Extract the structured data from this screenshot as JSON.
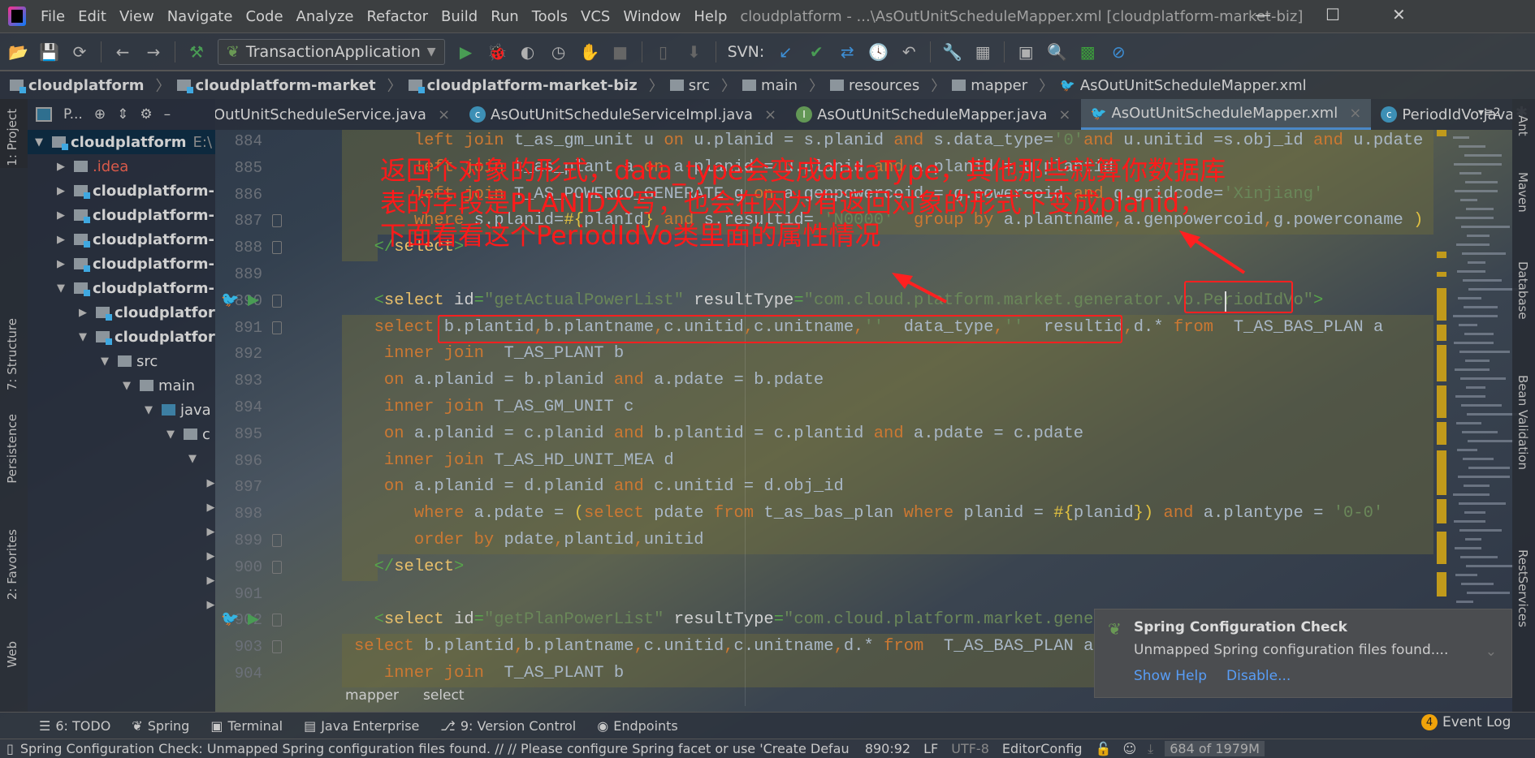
{
  "window": {
    "title": "cloudplatform - ...\\AsOutUnitScheduleMapper.xml [cloudplatform-market-biz]",
    "menu": [
      "File",
      "Edit",
      "View",
      "Navigate",
      "Code",
      "Analyze",
      "Refactor",
      "Build",
      "Run",
      "Tools",
      "VCS",
      "Window",
      "Help"
    ]
  },
  "toolbar": {
    "run_config": "TransactionApplication",
    "svn_label": "SVN:"
  },
  "breadcrumbs": [
    "cloudplatform",
    "cloudplatform-market",
    "cloudplatform-market-biz",
    "src",
    "main",
    "resources",
    "mapper",
    "AsOutUnitScheduleMapper.xml"
  ],
  "project_panel": {
    "view_label": "P...",
    "tree": [
      {
        "label": "cloudplatform",
        "suffix": "E:\\",
        "expanded": true,
        "depth": 0,
        "selected": true
      },
      {
        "label": ".idea",
        "expanded": false,
        "depth": 1
      },
      {
        "label": "cloudplatform-",
        "expanded": false,
        "depth": 1
      },
      {
        "label": "cloudplatform-",
        "expanded": false,
        "depth": 1
      },
      {
        "label": "cloudplatform-",
        "expanded": false,
        "depth": 1
      },
      {
        "label": "cloudplatform-",
        "expanded": false,
        "depth": 1
      },
      {
        "label": "cloudplatform-",
        "expanded": true,
        "depth": 1
      },
      {
        "label": "cloudplatfor",
        "expanded": false,
        "depth": 2
      },
      {
        "label": "cloudplatfor",
        "expanded": true,
        "depth": 2
      },
      {
        "label": "src",
        "expanded": true,
        "depth": 3
      },
      {
        "label": "main",
        "expanded": true,
        "depth": 4
      },
      {
        "label": "java",
        "expanded": true,
        "depth": 5
      },
      {
        "label": "c",
        "expanded": true,
        "depth": 6
      },
      {
        "label": "",
        "expanded": true,
        "depth": 7
      },
      {
        "label": "",
        "expanded": false,
        "depth": 8
      },
      {
        "label": "",
        "expanded": false,
        "depth": 8
      },
      {
        "label": "",
        "expanded": false,
        "depth": 8
      },
      {
        "label": "",
        "expanded": false,
        "depth": 8
      },
      {
        "label": "",
        "expanded": false,
        "depth": 8
      },
      {
        "label": "",
        "expanded": false,
        "depth": 8
      }
    ]
  },
  "left_tool_windows": [
    "1: Project",
    "7: Structure",
    "Persistence",
    "2: Favorites",
    "Web"
  ],
  "right_tool_windows": [
    "Ant",
    "Maven",
    "Database",
    "Bean Validation",
    "RestServices"
  ],
  "tabs": [
    {
      "label": "OutUnitScheduleService.java",
      "icon": "interface",
      "active": false
    },
    {
      "label": "AsOutUnitScheduleServiceImpl.java",
      "icon": "class",
      "active": false
    },
    {
      "label": "AsOutUnitScheduleMapper.java",
      "icon": "interface",
      "active": false
    },
    {
      "label": "AsOutUnitScheduleMapper.xml",
      "icon": "mybatis",
      "active": true
    },
    {
      "label": "PeriodIdVo.java",
      "icon": "class",
      "active": false
    }
  ],
  "tabs_overflow": "2",
  "editor": {
    "lines": [
      {
        "n": 884,
        "tokens": [
          [
            "t",
            "      "
          ],
          [
            "k",
            "left join"
          ],
          [
            "t",
            " t_as_gm_unit u "
          ],
          [
            "k",
            "on"
          ],
          [
            "t",
            " u.planid = s.planid "
          ],
          [
            "k",
            "and"
          ],
          [
            "t",
            " s.data_type="
          ],
          [
            "s",
            "'0'"
          ],
          [
            "k",
            "and"
          ],
          [
            "t",
            " u.unitid =s.obj_id "
          ],
          [
            "k",
            "and"
          ],
          [
            "t",
            " u.pdate = s.p"
          ]
        ]
      },
      {
        "n": 885,
        "tokens": [
          [
            "t",
            "      "
          ],
          [
            "k",
            "left join"
          ],
          [
            "t",
            " t_as_plant a "
          ],
          [
            "k",
            "on"
          ],
          [
            "t",
            " a.planid = u.planid "
          ],
          [
            "k",
            "and"
          ],
          [
            "t",
            " a.planid = u.plantid"
          ]
        ]
      },
      {
        "n": 886,
        "tokens": [
          [
            "t",
            "      "
          ],
          [
            "k",
            "left join"
          ],
          [
            "t",
            " T_AS_POWERCO_GENERATE g "
          ],
          [
            "k",
            "on"
          ],
          [
            "t",
            " a.genpowercoid = g.powercoid "
          ],
          [
            "k",
            "and"
          ],
          [
            "t",
            " g.gridcode="
          ],
          [
            "s",
            "'Xinjiang'"
          ]
        ]
      },
      {
        "n": 887,
        "tokens": [
          [
            "t",
            "      "
          ],
          [
            "k",
            "where"
          ],
          [
            "t",
            " s.planid="
          ],
          [
            "b",
            "#{"
          ],
          [
            "t",
            "planId"
          ],
          [
            "b",
            "}"
          ],
          [
            "t",
            " "
          ],
          [
            "k",
            "and"
          ],
          [
            "t",
            " s.resultid= "
          ],
          [
            "s",
            "'N0000'"
          ],
          [
            "t",
            "  "
          ],
          [
            "k",
            "group by"
          ],
          [
            "t",
            " a.plantname"
          ],
          [
            "k",
            ","
          ],
          [
            "t",
            "a.genpowercoid"
          ],
          [
            "k",
            ","
          ],
          [
            "t",
            "g.powerconame "
          ],
          [
            "b",
            ")"
          ],
          [
            "t",
            " w "
          ],
          [
            "k",
            "order"
          ]
        ]
      },
      {
        "n": 888,
        "tokens": [
          [
            "t",
            "  "
          ],
          [
            "p",
            "</"
          ],
          [
            "g",
            "select"
          ],
          [
            "p",
            ">"
          ]
        ]
      },
      {
        "n": 889,
        "tokens": []
      },
      {
        "n": 890,
        "tokens": [
          [
            "t",
            "  "
          ],
          [
            "p",
            "<"
          ],
          [
            "g",
            "select"
          ],
          [
            "a",
            " id"
          ],
          [
            "p",
            "="
          ],
          [
            "s",
            "\"getActualPowerList\""
          ],
          [
            "a",
            " resultType"
          ],
          [
            "p",
            "="
          ],
          [
            "s",
            "\"com.cloud.platform.market.generator.vo.PeriodIdVo\""
          ],
          [
            "p",
            ">"
          ]
        ]
      },
      {
        "n": 891,
        "tokens": [
          [
            "t",
            "  "
          ],
          [
            "k",
            "select"
          ],
          [
            "t",
            " b.plantid"
          ],
          [
            "k",
            ","
          ],
          [
            "t",
            "b.plantname"
          ],
          [
            "k",
            ","
          ],
          [
            "t",
            "c.unitid"
          ],
          [
            "k",
            ","
          ],
          [
            "t",
            "c.unitname"
          ],
          [
            "k",
            ","
          ],
          [
            "s",
            "''"
          ],
          [
            "t",
            "  data_type"
          ],
          [
            "k",
            ","
          ],
          [
            "s",
            "''"
          ],
          [
            "t",
            "  resultid"
          ],
          [
            "k",
            ","
          ],
          [
            "t",
            "d.* "
          ],
          [
            "k",
            "from"
          ],
          [
            "t",
            "  T_AS_BAS_PLAN a"
          ]
        ]
      },
      {
        "n": 892,
        "tokens": [
          [
            "t",
            "   "
          ],
          [
            "k",
            "inner join"
          ],
          [
            "t",
            "  T_AS_PLANT b"
          ]
        ]
      },
      {
        "n": 893,
        "tokens": [
          [
            "t",
            "   "
          ],
          [
            "k",
            "on"
          ],
          [
            "t",
            " a.planid = b.planid "
          ],
          [
            "k",
            "and"
          ],
          [
            "t",
            " a.pdate = b.pdate"
          ]
        ]
      },
      {
        "n": 894,
        "tokens": [
          [
            "t",
            "   "
          ],
          [
            "k",
            "inner join"
          ],
          [
            "t",
            " T_AS_GM_UNIT c"
          ]
        ]
      },
      {
        "n": 895,
        "tokens": [
          [
            "t",
            "   "
          ],
          [
            "k",
            "on"
          ],
          [
            "t",
            " a.planid = c.planid "
          ],
          [
            "k",
            "and"
          ],
          [
            "t",
            " b.plantid = c.plantid "
          ],
          [
            "k",
            "and"
          ],
          [
            "t",
            " a.pdate = c.pdate"
          ]
        ]
      },
      {
        "n": 896,
        "tokens": [
          [
            "t",
            "   "
          ],
          [
            "k",
            "inner join"
          ],
          [
            "t",
            " T_AS_HD_UNIT_MEA d"
          ]
        ]
      },
      {
        "n": 897,
        "tokens": [
          [
            "t",
            "   "
          ],
          [
            "k",
            "on"
          ],
          [
            "t",
            " a.planid = d.planid "
          ],
          [
            "k",
            "and"
          ],
          [
            "t",
            " c.unitid = d.obj_id"
          ]
        ]
      },
      {
        "n": 898,
        "tokens": [
          [
            "t",
            "      "
          ],
          [
            "k",
            "where"
          ],
          [
            "t",
            " a.pdate = "
          ],
          [
            "b",
            "("
          ],
          [
            "k",
            "select"
          ],
          [
            "t",
            " pdate "
          ],
          [
            "k",
            "from"
          ],
          [
            "t",
            " t_as_bas_plan "
          ],
          [
            "k",
            "where"
          ],
          [
            "t",
            " planid = "
          ],
          [
            "b",
            "#{"
          ],
          [
            "t",
            "planid"
          ],
          [
            "b",
            "})"
          ],
          [
            "t",
            " "
          ],
          [
            "k",
            "and"
          ],
          [
            "t",
            " a.plantype = "
          ],
          [
            "s",
            "'0-0'"
          ]
        ]
      },
      {
        "n": 899,
        "tokens": [
          [
            "t",
            "      "
          ],
          [
            "k",
            "order by"
          ],
          [
            "t",
            " pdate"
          ],
          [
            "k",
            ","
          ],
          [
            "t",
            "plantid"
          ],
          [
            "k",
            ","
          ],
          [
            "t",
            "unitid"
          ]
        ]
      },
      {
        "n": 900,
        "tokens": [
          [
            "t",
            "  "
          ],
          [
            "p",
            "</"
          ],
          [
            "g",
            "select"
          ],
          [
            "p",
            ">"
          ]
        ]
      },
      {
        "n": 901,
        "tokens": []
      },
      {
        "n": 902,
        "tokens": [
          [
            "t",
            "  "
          ],
          [
            "p",
            "<"
          ],
          [
            "g",
            "select"
          ],
          [
            "a",
            " id"
          ],
          [
            "p",
            "="
          ],
          [
            "s",
            "\"getPlanPowerList\""
          ],
          [
            "a",
            " resultType"
          ],
          [
            "p",
            "="
          ],
          [
            "s",
            "\"com.cloud.platform.market.genera"
          ]
        ]
      },
      {
        "n": 903,
        "tokens": [
          [
            "k",
            "select"
          ],
          [
            "t",
            " b.plantid"
          ],
          [
            "k",
            ","
          ],
          [
            "t",
            "b.plantname"
          ],
          [
            "k",
            ","
          ],
          [
            "t",
            "c.unitid"
          ],
          [
            "k",
            ","
          ],
          [
            "t",
            "c.unitname"
          ],
          [
            "k",
            ","
          ],
          [
            "t",
            "d.* "
          ],
          [
            "k",
            "from"
          ],
          [
            "t",
            "  T_AS_BAS_PLAN a"
          ]
        ]
      },
      {
        "n": 904,
        "tokens": [
          [
            "t",
            "   "
          ],
          [
            "k",
            "inner join"
          ],
          [
            "t",
            "  T_AS_PLANT b"
          ]
        ]
      }
    ],
    "breadcrumb": [
      "mapper",
      "select"
    ]
  },
  "annotation": {
    "lines": [
      "返回个对象的形式，data_type会变成dataType，其他那些就算你数据库",
      "表的字段是PLANID大写，也会在因为有返回对象的形式下变成planid，",
      "下面看看这个PeriodIdVo类里面的属性情况"
    ],
    "color": "#ff1a1a"
  },
  "notification": {
    "title": "Spring Configuration Check",
    "body": "Unmapped Spring configuration files found....",
    "actions": [
      "Show Help",
      "Disable..."
    ]
  },
  "tool_windows": [
    {
      "label": "6: TODO",
      "icon": "list-icon"
    },
    {
      "label": "Spring",
      "icon": "spring-icon"
    },
    {
      "label": "Terminal",
      "icon": "terminal-icon"
    },
    {
      "label": "Java Enterprise",
      "icon": "java-ee-icon"
    },
    {
      "label": "9: Version Control",
      "icon": "vcs-icon"
    },
    {
      "label": "Endpoints",
      "icon": "globe-icon"
    }
  ],
  "event_log": {
    "label": "Event Log",
    "count": "4"
  },
  "status": {
    "message": "Spring Configuration Check: Unmapped Spring configuration files found. // // Please configure Spring facet or use 'Create Default Con... (moments ago)",
    "position": "890:92",
    "line_sep": "LF",
    "encoding": "UTF-8",
    "editorconfig": "EditorConfig",
    "memory": "684 of 1979M"
  }
}
